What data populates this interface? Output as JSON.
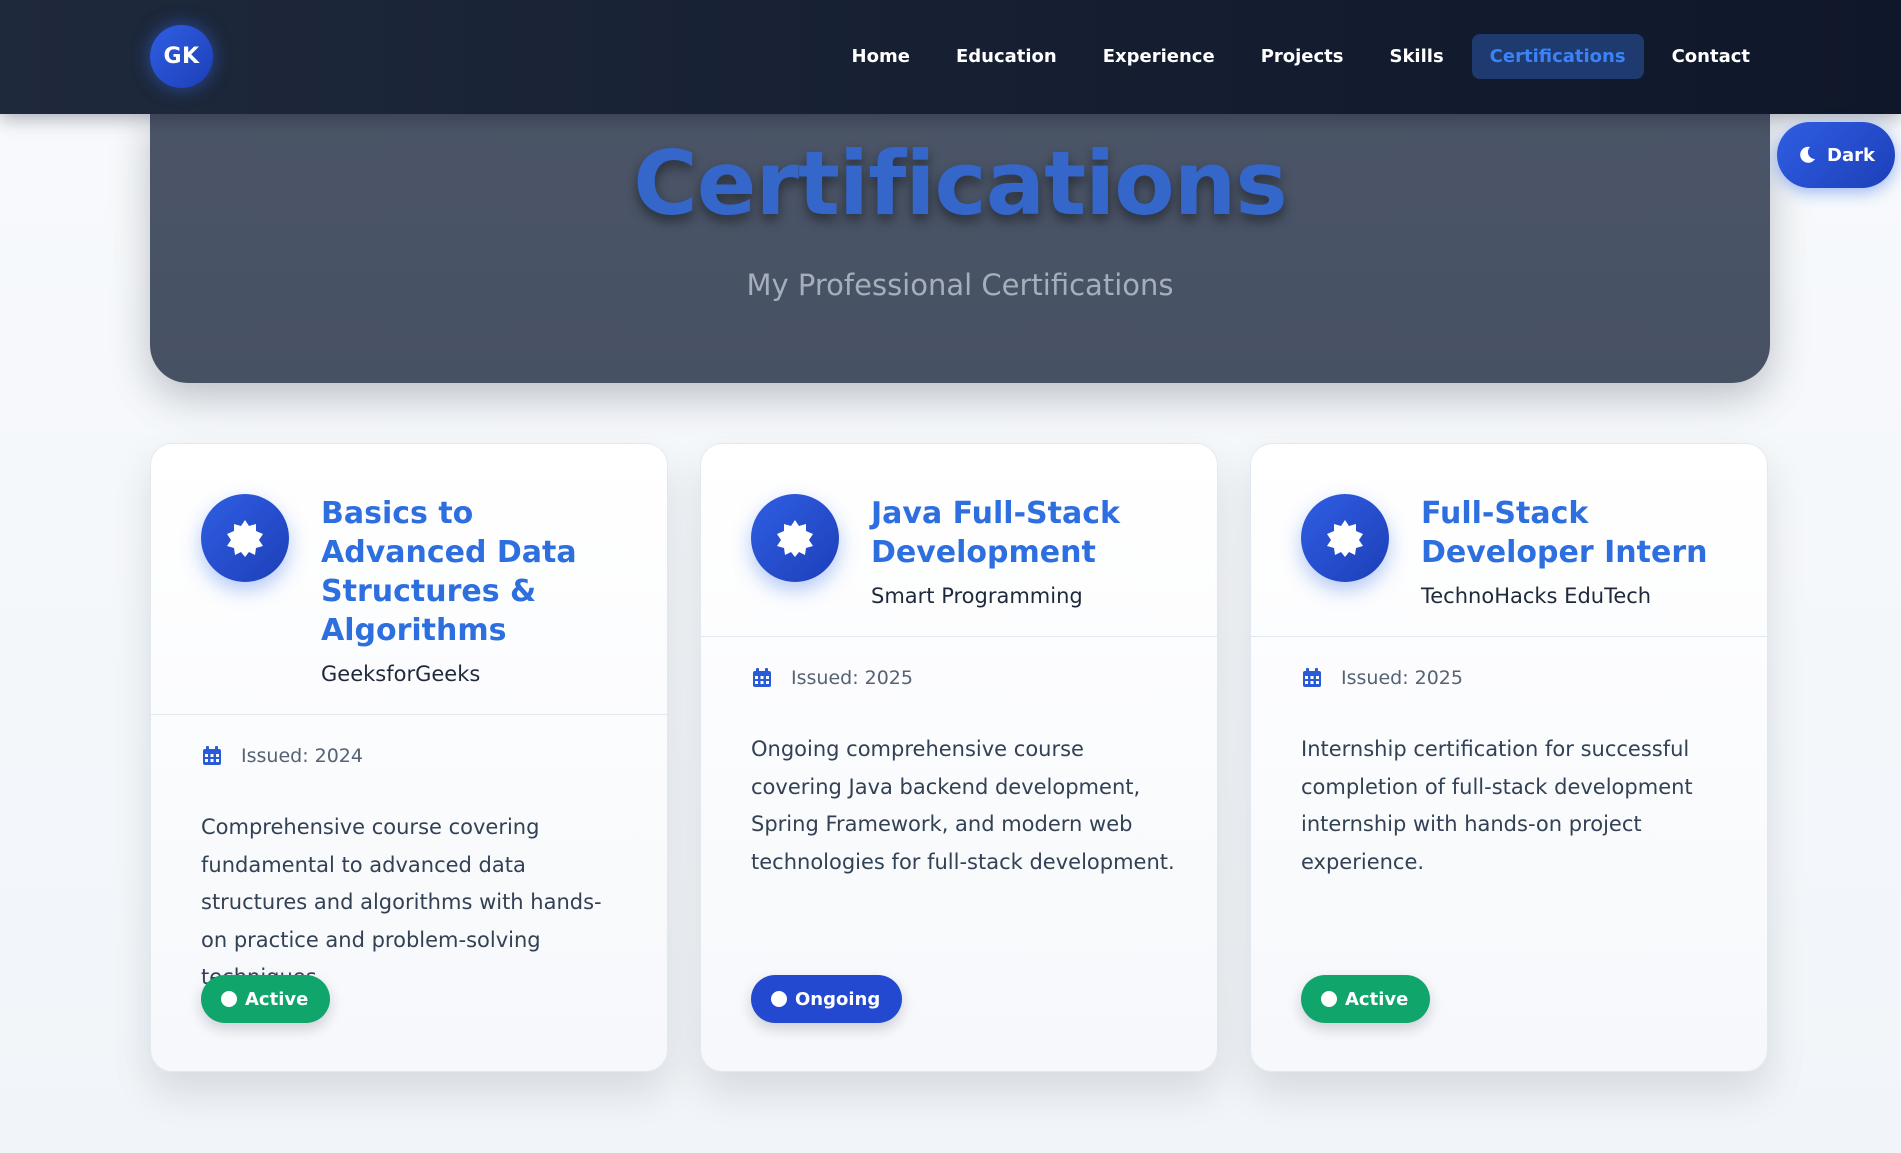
{
  "nav": {
    "logo": "GK",
    "links": [
      "Home",
      "Education",
      "Experience",
      "Projects",
      "Skills",
      "Certifications",
      "Contact"
    ],
    "active": "Certifications"
  },
  "theme_toggle": {
    "label": "Dark",
    "icon": "moon-icon"
  },
  "hero": {
    "title": "Certifications",
    "subtitle": "My Professional Certifications"
  },
  "cards": [
    {
      "title": "Basics to Advanced Data Structures & Algorithms",
      "issuer": "GeeksforGeeks",
      "issued": "Issued: 2024",
      "description": "Comprehensive course covering fundamental to advanced data structures and algorithms with hands-on practice and problem-solving techniques.",
      "status": "Active",
      "status_color": "#10a66b"
    },
    {
      "title": "Java Full-Stack Development",
      "issuer": "Smart Programming",
      "issued": "Issued: 2025",
      "description": "Ongoing comprehensive course covering Java backend development, Spring Framework, and modern web technologies for full-stack development.",
      "status": "Ongoing",
      "status_color": "#2349d1"
    },
    {
      "title": "Full-Stack Developer Intern",
      "issuer": "TechnoHacks EduTech",
      "issued": "Issued: 2025",
      "description": "Internship certification for successful completion of full-stack development internship with hands-on project experience.",
      "status": "Active",
      "status_color": "#10a66b"
    }
  ],
  "colors": {
    "accent": "#2e6fe0",
    "nav_bg": "#1e293b",
    "hero_bg": "#4b5567"
  }
}
